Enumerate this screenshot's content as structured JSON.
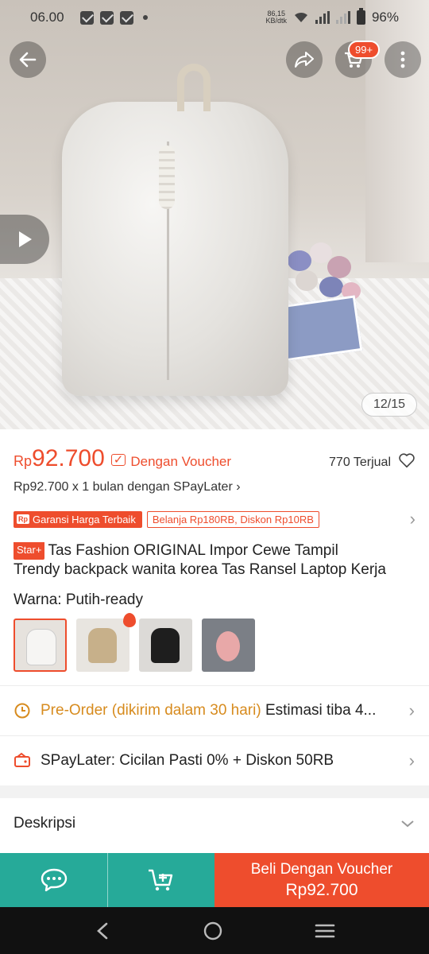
{
  "status_bar": {
    "time": "06.00",
    "net_speed_value": "86,15",
    "net_speed_unit": "KB/dtk",
    "battery": "96%"
  },
  "hero": {
    "cart_badge": "99+",
    "image_counter": "12/15"
  },
  "product": {
    "price_currency": "Rp",
    "price_value": "92.700",
    "voucher_label": "Dengan Voucher",
    "sold": "770 Terjual",
    "spaylater_line": "Rp92.700 x 1 bulan dengan SPayLater ›",
    "guarantee_badge": "Garansi Harga Terbaik",
    "guarantee_icon_text": "Rp",
    "promo_badge": "Belanja Rp180RB, Diskon Rp10RB",
    "star_badge": "Star+",
    "title_line1": "Tas Fashion ORIGINAL Impor Cewe Tampil",
    "title_line2": "Trendy backpack wanita korea Tas Ransel Laptop Kerja",
    "variant_label": "Warna: Putih-ready"
  },
  "rows": {
    "preorder_highlight": "Pre-Order (dikirim dalam 30 hari)",
    "preorder_rest": " Estimasi tiba 4...",
    "spaylater": "SPayLater: Cicilan Pasti 0% + Diskon 50RB",
    "description": "Deskripsi"
  },
  "bottom_bar": {
    "buy_label": "Beli Dengan Voucher",
    "buy_price": "Rp92.700"
  },
  "colors": {
    "brand": "#ee4d2d",
    "teal": "#26aa99",
    "preorder": "#d78b1e"
  }
}
